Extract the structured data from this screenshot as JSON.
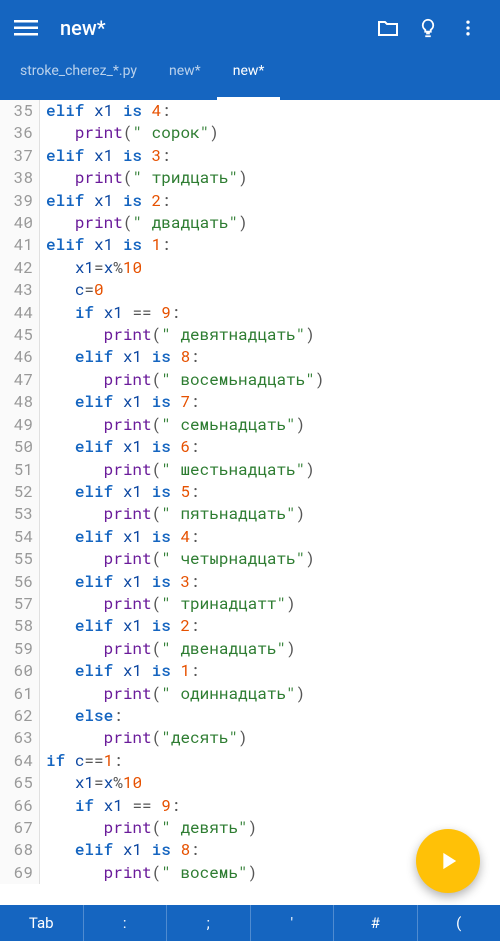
{
  "header": {
    "title": "new*"
  },
  "tabs": [
    {
      "label": "stroke_cherez_*.py",
      "active": false
    },
    {
      "label": "new*",
      "active": false
    },
    {
      "label": "new*",
      "active": true
    }
  ],
  "bottombar": [
    "Tab",
    ":",
    ";",
    "'",
    "#",
    "("
  ],
  "code_lines": [
    {
      "n": 35,
      "tokens": [
        [
          "",
          "elif",
          "kw"
        ],
        [
          " ",
          "x1",
          "var"
        ],
        [
          " ",
          "is",
          "kw"
        ],
        [
          " ",
          "4",
          "num"
        ],
        [
          "",
          ":",
          "op"
        ]
      ]
    },
    {
      "n": 36,
      "tokens": [
        [
          "   ",
          "print",
          "fn"
        ],
        [
          "",
          "(",
          "op"
        ],
        [
          "",
          "\" сорок\"",
          "str"
        ],
        [
          "",
          ")",
          "op"
        ]
      ]
    },
    {
      "n": 37,
      "tokens": [
        [
          "",
          "elif",
          "kw"
        ],
        [
          " ",
          "x1",
          "var"
        ],
        [
          " ",
          "is",
          "kw"
        ],
        [
          " ",
          "3",
          "num"
        ],
        [
          "",
          ":",
          "op"
        ]
      ]
    },
    {
      "n": 38,
      "tokens": [
        [
          "   ",
          "print",
          "fn"
        ],
        [
          "",
          "(",
          "op"
        ],
        [
          "",
          "\" тридцать\"",
          "str"
        ],
        [
          "",
          ")",
          "op"
        ]
      ]
    },
    {
      "n": 39,
      "tokens": [
        [
          "",
          "elif",
          "kw"
        ],
        [
          " ",
          "x1",
          "var"
        ],
        [
          " ",
          "is",
          "kw"
        ],
        [
          " ",
          "2",
          "num"
        ],
        [
          "",
          ":",
          "op"
        ]
      ]
    },
    {
      "n": 40,
      "tokens": [
        [
          "   ",
          "print",
          "fn"
        ],
        [
          "",
          "(",
          "op"
        ],
        [
          "",
          "\" двадцать\"",
          "str"
        ],
        [
          "",
          ")",
          "op"
        ]
      ]
    },
    {
      "n": 41,
      "tokens": [
        [
          "",
          "elif",
          "kw"
        ],
        [
          " ",
          "x1",
          "var"
        ],
        [
          " ",
          "is",
          "kw"
        ],
        [
          " ",
          "1",
          "num"
        ],
        [
          "",
          ":",
          "op"
        ]
      ]
    },
    {
      "n": 42,
      "tokens": [
        [
          "   ",
          "x1",
          "var"
        ],
        [
          "",
          "=",
          "op"
        ],
        [
          "",
          "x",
          "var"
        ],
        [
          "",
          "%",
          "op"
        ],
        [
          "",
          "10",
          "num"
        ]
      ]
    },
    {
      "n": 43,
      "tokens": [
        [
          "   ",
          "c",
          "var"
        ],
        [
          "",
          "=",
          "op"
        ],
        [
          "",
          "0",
          "num"
        ]
      ]
    },
    {
      "n": 44,
      "tokens": [
        [
          "   ",
          "if",
          "kw"
        ],
        [
          " ",
          "x1",
          "var"
        ],
        [
          " ",
          "==",
          "op"
        ],
        [
          " ",
          "9",
          "num"
        ],
        [
          "",
          ":",
          "op"
        ]
      ]
    },
    {
      "n": 45,
      "tokens": [
        [
          "      ",
          "print",
          "fn"
        ],
        [
          "",
          "(",
          "op"
        ],
        [
          "",
          "\" девятнадцать\"",
          "str"
        ],
        [
          "",
          ")",
          "op"
        ]
      ]
    },
    {
      "n": 46,
      "tokens": [
        [
          "   ",
          "elif",
          "kw"
        ],
        [
          " ",
          "x1",
          "var"
        ],
        [
          " ",
          "is",
          "kw"
        ],
        [
          " ",
          "8",
          "num"
        ],
        [
          "",
          ":",
          "op"
        ]
      ]
    },
    {
      "n": 47,
      "tokens": [
        [
          "      ",
          "print",
          "fn"
        ],
        [
          "",
          "(",
          "op"
        ],
        [
          "",
          "\" восемьнадцать\"",
          "str"
        ],
        [
          "",
          ")",
          "op"
        ]
      ]
    },
    {
      "n": 48,
      "tokens": [
        [
          "   ",
          "elif",
          "kw"
        ],
        [
          " ",
          "x1",
          "var"
        ],
        [
          " ",
          "is",
          "kw"
        ],
        [
          " ",
          "7",
          "num"
        ],
        [
          "",
          ":",
          "op"
        ]
      ]
    },
    {
      "n": 49,
      "tokens": [
        [
          "      ",
          "print",
          "fn"
        ],
        [
          "",
          "(",
          "op"
        ],
        [
          "",
          "\" семьнадцать\"",
          "str"
        ],
        [
          "",
          ")",
          "op"
        ]
      ]
    },
    {
      "n": 50,
      "tokens": [
        [
          "   ",
          "elif",
          "kw"
        ],
        [
          " ",
          "x1",
          "var"
        ],
        [
          " ",
          "is",
          "kw"
        ],
        [
          " ",
          "6",
          "num"
        ],
        [
          "",
          ":",
          "op"
        ]
      ]
    },
    {
      "n": 51,
      "tokens": [
        [
          "      ",
          "print",
          "fn"
        ],
        [
          "",
          "(",
          "op"
        ],
        [
          "",
          "\" шестьнадцать\"",
          "str"
        ],
        [
          "",
          ")",
          "op"
        ]
      ]
    },
    {
      "n": 52,
      "tokens": [
        [
          "   ",
          "elif",
          "kw"
        ],
        [
          " ",
          "x1",
          "var"
        ],
        [
          " ",
          "is",
          "kw"
        ],
        [
          " ",
          "5",
          "num"
        ],
        [
          "",
          ":",
          "op"
        ]
      ]
    },
    {
      "n": 53,
      "tokens": [
        [
          "      ",
          "print",
          "fn"
        ],
        [
          "",
          "(",
          "op"
        ],
        [
          "",
          "\" пятьнадцать\"",
          "str"
        ],
        [
          "",
          ")",
          "op"
        ]
      ]
    },
    {
      "n": 54,
      "tokens": [
        [
          "   ",
          "elif",
          "kw"
        ],
        [
          " ",
          "x1",
          "var"
        ],
        [
          " ",
          "is",
          "kw"
        ],
        [
          " ",
          "4",
          "num"
        ],
        [
          "",
          ":",
          "op"
        ]
      ]
    },
    {
      "n": 55,
      "tokens": [
        [
          "      ",
          "print",
          "fn"
        ],
        [
          "",
          "(",
          "op"
        ],
        [
          "",
          "\" четырнадцать\"",
          "str"
        ],
        [
          "",
          ")",
          "op"
        ]
      ]
    },
    {
      "n": 56,
      "tokens": [
        [
          "   ",
          "elif",
          "kw"
        ],
        [
          " ",
          "x1",
          "var"
        ],
        [
          " ",
          "is",
          "kw"
        ],
        [
          " ",
          "3",
          "num"
        ],
        [
          "",
          ":",
          "op"
        ]
      ]
    },
    {
      "n": 57,
      "tokens": [
        [
          "      ",
          "print",
          "fn"
        ],
        [
          "",
          "(",
          "op"
        ],
        [
          "",
          "\" тринадцатт\"",
          "str"
        ],
        [
          "",
          ")",
          "op"
        ]
      ]
    },
    {
      "n": 58,
      "tokens": [
        [
          "   ",
          "elif",
          "kw"
        ],
        [
          " ",
          "x1",
          "var"
        ],
        [
          " ",
          "is",
          "kw"
        ],
        [
          " ",
          "2",
          "num"
        ],
        [
          "",
          ":",
          "op"
        ]
      ]
    },
    {
      "n": 59,
      "tokens": [
        [
          "      ",
          "print",
          "fn"
        ],
        [
          "",
          "(",
          "op"
        ],
        [
          "",
          "\" двенадцать\"",
          "str"
        ],
        [
          "",
          ")",
          "op"
        ]
      ]
    },
    {
      "n": 60,
      "tokens": [
        [
          "   ",
          "elif",
          "kw"
        ],
        [
          " ",
          "x1",
          "var"
        ],
        [
          " ",
          "is",
          "kw"
        ],
        [
          " ",
          "1",
          "num"
        ],
        [
          "",
          ":",
          "op"
        ]
      ]
    },
    {
      "n": 61,
      "tokens": [
        [
          "      ",
          "print",
          "fn"
        ],
        [
          "",
          "(",
          "op"
        ],
        [
          "",
          "\" одиннадцать\"",
          "str"
        ],
        [
          "",
          ")",
          "op"
        ]
      ]
    },
    {
      "n": 62,
      "tokens": [
        [
          "   ",
          "else",
          "kw"
        ],
        [
          "",
          ":",
          "op"
        ]
      ]
    },
    {
      "n": 63,
      "tokens": [
        [
          "      ",
          "print",
          "fn"
        ],
        [
          "",
          "(",
          "op"
        ],
        [
          "",
          "\"десять\"",
          "str"
        ],
        [
          "",
          ")",
          "op"
        ]
      ]
    },
    {
      "n": 64,
      "tokens": [
        [
          "",
          "if",
          "kw"
        ],
        [
          " ",
          "c",
          "var"
        ],
        [
          "",
          "==",
          "op"
        ],
        [
          "",
          "1",
          "num"
        ],
        [
          "",
          ":",
          "op"
        ]
      ]
    },
    {
      "n": 65,
      "tokens": [
        [
          "   ",
          "x1",
          "var"
        ],
        [
          "",
          "=",
          "op"
        ],
        [
          "",
          "x",
          "var"
        ],
        [
          "",
          "%",
          "op"
        ],
        [
          "",
          "10",
          "num"
        ]
      ]
    },
    {
      "n": 66,
      "tokens": [
        [
          "   ",
          "if",
          "kw"
        ],
        [
          " ",
          "x1",
          "var"
        ],
        [
          " ",
          "==",
          "op"
        ],
        [
          " ",
          "9",
          "num"
        ],
        [
          "",
          ":",
          "op"
        ]
      ]
    },
    {
      "n": 67,
      "tokens": [
        [
          "      ",
          "print",
          "fn"
        ],
        [
          "",
          "(",
          "op"
        ],
        [
          "",
          "\" девять\"",
          "str"
        ],
        [
          "",
          ")",
          "op"
        ]
      ]
    },
    {
      "n": 68,
      "tokens": [
        [
          "   ",
          "elif",
          "kw"
        ],
        [
          " ",
          "x1",
          "var"
        ],
        [
          " ",
          "is",
          "kw"
        ],
        [
          " ",
          "8",
          "num"
        ],
        [
          "",
          ":",
          "op"
        ]
      ]
    },
    {
      "n": 69,
      "tokens": [
        [
          "      ",
          "print",
          "fn"
        ],
        [
          "",
          "(",
          "op"
        ],
        [
          "",
          "\" восемь\"",
          "str"
        ],
        [
          "",
          ")",
          "op"
        ]
      ]
    }
  ]
}
